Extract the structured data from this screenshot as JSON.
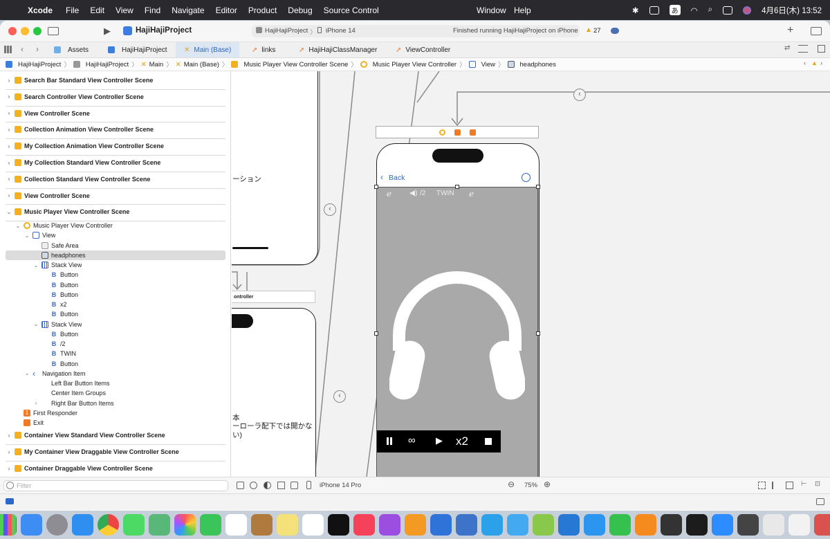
{
  "menubar": {
    "app_name": "Xcode",
    "menus": [
      "File",
      "Edit",
      "View",
      "Find",
      "Navigate",
      "Editor",
      "Product",
      "Debug",
      "Source Control"
    ],
    "menus_right": [
      "Window",
      "Help"
    ],
    "input_mode": "あ",
    "datetime": "4月6日(木)  13:52"
  },
  "toolbar": {
    "project_name": "HajiHajiProject",
    "scheme": "HajiHajiProject",
    "device": "iPhone 14",
    "status": "Finished running HajiHajiProject on iPhone",
    "warning_count": "27"
  },
  "tabs": [
    {
      "label": "Assets",
      "active": false
    },
    {
      "label": "HajiHajiProject",
      "active": false
    },
    {
      "label": "Main (Base)",
      "active": true
    },
    {
      "label": "links",
      "active": false
    },
    {
      "label": "HajiHajiClassManager",
      "active": false
    },
    {
      "label": "ViewController",
      "active": false
    }
  ],
  "breadcrumb": [
    "HajiHajiProject",
    "HajiHajiProject",
    "Main",
    "Main (Base)",
    "Music Player View Controller Scene",
    "Music Player View Controller",
    "View",
    "headphones"
  ],
  "navigator": {
    "rows": [
      {
        "label": "Search Bar Standard View Controller Scene",
        "level": 0,
        "icon": "scene",
        "disclosure": "›",
        "kind": "scene"
      },
      {
        "label": "Search Controller View Controller Scene",
        "level": 0,
        "icon": "scene",
        "disclosure": "›",
        "kind": "scene"
      },
      {
        "label": "View Controller Scene",
        "level": 0,
        "icon": "scene",
        "disclosure": "›",
        "kind": "scene"
      },
      {
        "label": "Collection Animation View Controller Scene",
        "level": 0,
        "icon": "scene",
        "disclosure": "›",
        "kind": "scene"
      },
      {
        "label": "My Collection Animation View Controller Scene",
        "level": 0,
        "icon": "scene",
        "disclosure": "›",
        "kind": "scene"
      },
      {
        "label": "My Collection Standard View Controller Scene",
        "level": 0,
        "icon": "scene",
        "disclosure": "›",
        "kind": "scene"
      },
      {
        "label": "Collection Standard View Controller Scene",
        "level": 0,
        "icon": "scene",
        "disclosure": "›",
        "kind": "scene"
      },
      {
        "label": "View Controller Scene",
        "level": 0,
        "icon": "scene",
        "disclosure": "›",
        "kind": "scene"
      },
      {
        "label": "Music Player View Controller Scene",
        "level": 0,
        "icon": "scene",
        "disclosure": "⌄",
        "kind": "scene"
      },
      {
        "label": "Music Player View Controller",
        "level": 1,
        "icon": "vc",
        "disclosure": "⌄",
        "kind": "item"
      },
      {
        "label": "View",
        "level": 2,
        "icon": "view",
        "disclosure": "⌄",
        "kind": "item"
      },
      {
        "label": "Safe Area",
        "level": 3,
        "icon": "safearea",
        "disclosure": "",
        "kind": "item"
      },
      {
        "label": "headphones",
        "level": 3,
        "icon": "image",
        "disclosure": "",
        "kind": "selected"
      },
      {
        "label": "Stack View",
        "level": 3,
        "icon": "stack",
        "disclosure": "⌄",
        "kind": "item"
      },
      {
        "label": "Button",
        "level": 4,
        "icon": "button",
        "disclosure": "",
        "kind": "item"
      },
      {
        "label": "Button",
        "level": 4,
        "icon": "button",
        "disclosure": "",
        "kind": "item"
      },
      {
        "label": "Button",
        "level": 4,
        "icon": "button",
        "disclosure": "",
        "kind": "item"
      },
      {
        "label": "x2",
        "level": 4,
        "icon": "button",
        "disclosure": "",
        "kind": "item"
      },
      {
        "label": "Button",
        "level": 4,
        "icon": "button",
        "disclosure": "",
        "kind": "item"
      },
      {
        "label": "Stack View",
        "level": 3,
        "icon": "stack",
        "disclosure": "⌄",
        "kind": "item"
      },
      {
        "label": "Button",
        "level": 4,
        "icon": "button",
        "disclosure": "",
        "kind": "item"
      },
      {
        "label": "/2",
        "level": 4,
        "icon": "button",
        "disclosure": "",
        "kind": "item"
      },
      {
        "label": "TWIN",
        "level": 4,
        "icon": "button",
        "disclosure": "",
        "kind": "item"
      },
      {
        "label": "Button",
        "level": 4,
        "icon": "button",
        "disclosure": "",
        "kind": "item"
      },
      {
        "label": "Navigation Item",
        "level": 2,
        "icon": "navitem",
        "disclosure": "⌄",
        "kind": "item"
      },
      {
        "label": "Left Bar Button Items",
        "level": 3,
        "icon": "none",
        "disclosure": "",
        "kind": "item"
      },
      {
        "label": "Center Item Groups",
        "level": 3,
        "icon": "none",
        "disclosure": "",
        "kind": "item"
      },
      {
        "label": "Right Bar Button Items",
        "level": 3,
        "icon": "none",
        "disclosure": "›",
        "kind": "item"
      },
      {
        "label": "First Responder",
        "level": 1,
        "icon": "responder",
        "disclosure": "",
        "kind": "item"
      },
      {
        "label": "Exit",
        "level": 1,
        "icon": "exit",
        "disclosure": "",
        "kind": "item"
      },
      {
        "label": "Container View Standard View Controller Scene",
        "level": 0,
        "icon": "scene",
        "disclosure": "›",
        "kind": "scene"
      },
      {
        "label": "My Container View Draggable View Controller Scene",
        "level": 0,
        "icon": "scene",
        "disclosure": "›",
        "kind": "scene"
      },
      {
        "label": "Container Draggable View Controller Scene",
        "level": 0,
        "icon": "scene",
        "disclosure": "›",
        "kind": "scene"
      }
    ],
    "filter_placeholder": "Filter"
  },
  "canvas": {
    "left_scene_text_1": "ーション",
    "left_scene_header": "ontroller",
    "left_scene_text_2": "本",
    "left_scene_text_3": "ーローラ配下では開かな",
    "left_scene_text_4": "い)",
    "phone": {
      "back_label": "Back",
      "top_controls": [
        "ear-icon",
        "/2",
        "TWIN",
        "ear-icon"
      ],
      "half_label": "/2",
      "twin_label": "TWIN",
      "bottom_controls": [
        "pause-icon",
        "infinity-icon",
        "play-icon",
        "x2",
        "stop-icon"
      ],
      "x2_label": "x2",
      "image_name": "headphones"
    }
  },
  "bottombar": {
    "device_label": "iPhone 14 Pro",
    "zoom": "75%"
  },
  "colors": {
    "accent": "#2a67c9",
    "scene_icon": "#f3b021",
    "canvas_bg": "#f2f2f2",
    "phone_content": "#a9a9a9"
  }
}
